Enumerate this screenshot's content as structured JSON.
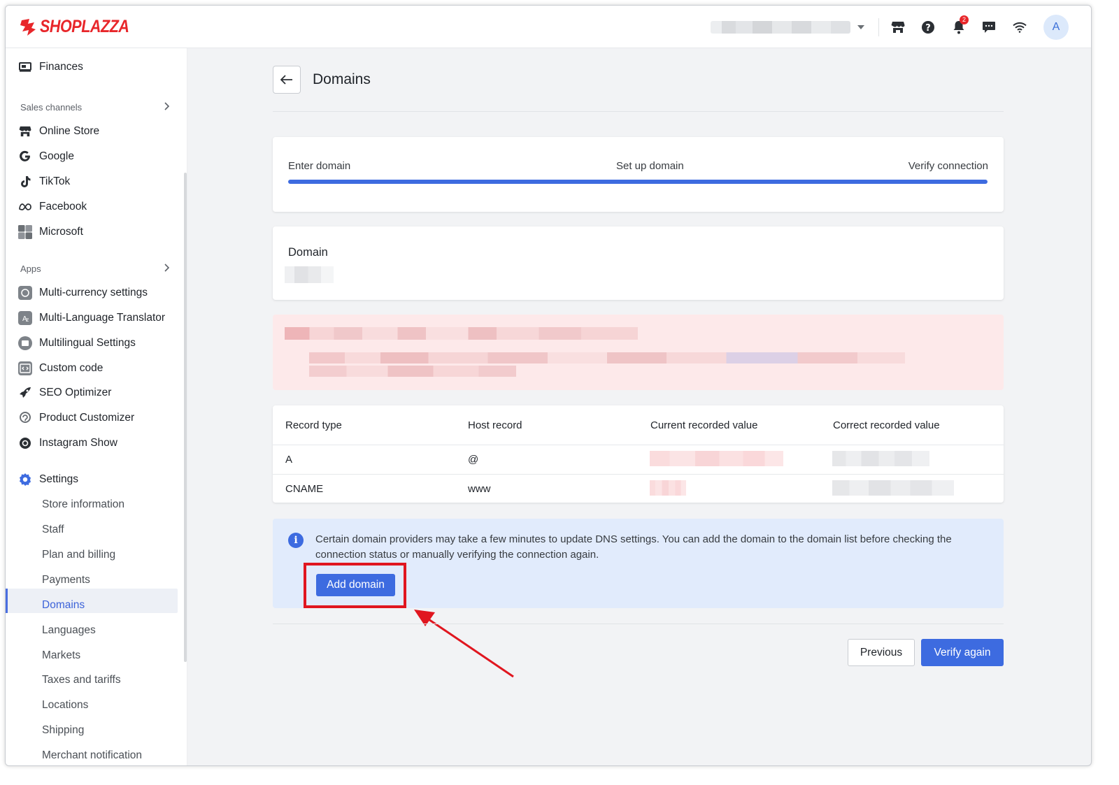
{
  "brand": {
    "name": "SHOPLAZZA",
    "color": "#e8262a"
  },
  "header": {
    "store_selector": {
      "value": ""
    },
    "icons": [
      "store-icon",
      "help-icon",
      "notification-icon",
      "message-icon",
      "wifi-icon"
    ],
    "notification_count": "2",
    "avatar_initial": "A"
  },
  "sidebar": {
    "top_item": {
      "label": "Finances",
      "icon": "finances-icon"
    },
    "sales_channels": {
      "title": "Sales channels",
      "items": [
        {
          "label": "Online Store",
          "icon": "store-icon"
        },
        {
          "label": "Google",
          "icon": "google-icon"
        },
        {
          "label": "TikTok",
          "icon": "tiktok-icon"
        },
        {
          "label": "Facebook",
          "icon": "meta-icon"
        },
        {
          "label": "Microsoft",
          "icon": "microsoft-icon"
        }
      ]
    },
    "apps": {
      "title": "Apps",
      "items": [
        {
          "label": "Multi-currency settings",
          "icon": "currency-icon"
        },
        {
          "label": "Multi-Language Translator",
          "icon": "translator-icon"
        },
        {
          "label": "Multilingual Settings",
          "icon": "multilingual-icon"
        },
        {
          "label": "Custom code",
          "icon": "code-icon"
        },
        {
          "label": "SEO Optimizer",
          "icon": "rocket-icon"
        },
        {
          "label": "Product Customizer",
          "icon": "customizer-icon"
        },
        {
          "label": "Instagram Show",
          "icon": "instagram-icon"
        }
      ]
    },
    "settings": {
      "title": "Settings",
      "items": [
        "Store information",
        "Staff",
        "Plan and billing",
        "Payments",
        "Domains",
        "Languages",
        "Markets",
        "Taxes and tariffs",
        "Locations",
        "Shipping",
        "Merchant notification"
      ],
      "active": "Domains"
    }
  },
  "page": {
    "title": "Domains",
    "steps": [
      "Enter domain",
      "Set up domain",
      "Verify connection"
    ],
    "progress_percent": 100,
    "domain_card": {
      "title": "Domain"
    },
    "dns_table": {
      "headers": [
        "Record type",
        "Host record",
        "Current recorded value",
        "Correct recorded value"
      ],
      "rows": [
        {
          "type": "A",
          "host": "@"
        },
        {
          "type": "CNAME",
          "host": "www"
        }
      ]
    },
    "info": {
      "text": "Certain domain providers may take a few minutes to update DNS settings. You can add the domain to the domain list before checking the connection status or manually verifying the connection again.",
      "button": "Add domain"
    },
    "footer": {
      "previous": "Previous",
      "verify": "Verify again"
    }
  },
  "colors": {
    "accent": "#3d6be0",
    "highlight": "#e0161f",
    "error_bg": "#fde9ea",
    "info_bg": "#e1ebfc"
  }
}
